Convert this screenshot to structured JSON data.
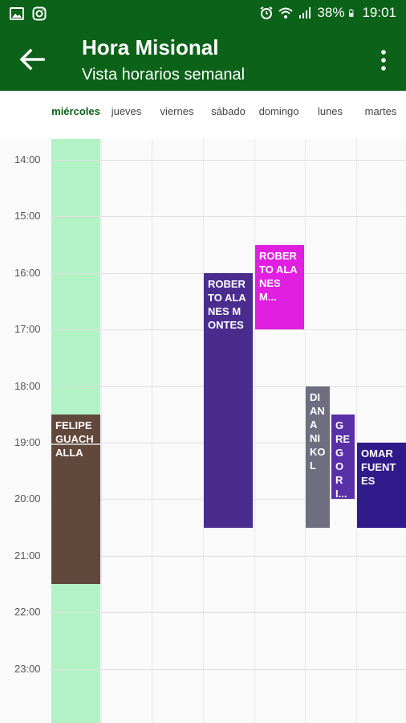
{
  "status_bar": {
    "battery": "38%",
    "time": "19:01"
  },
  "app_bar": {
    "title": "Hora Misional",
    "subtitle": "Vista horarios semanal"
  },
  "days": [
    "miércoles",
    "jueves",
    "viernes",
    "sábado",
    "domingo",
    "lunes",
    "martes"
  ],
  "hours": [
    "14:00",
    "15:00",
    "16:00",
    "17:00",
    "18:00",
    "19:00",
    "20:00",
    "21:00",
    "22:00",
    "23:00"
  ],
  "events": [
    {
      "text": "FELIPE GUACH ALLA",
      "day": "miércoles",
      "start": "18:30",
      "end": "21:30",
      "color": "#62473b"
    },
    {
      "text": "ROBERTO ALANES MONTES",
      "day": "sábado",
      "start": "16:00",
      "end": "20:30",
      "color": "#4a2c8f"
    },
    {
      "text": "ROBERTO ALANES M...",
      "day": "domingo",
      "start": "15:30",
      "end": "17:00",
      "color": "#e01fe0"
    },
    {
      "text": "DIANA NIKOL",
      "day": "lunes",
      "start": "18:00",
      "end": "20:30",
      "color": "#6e6e7f"
    },
    {
      "text": "GREGORI...",
      "day": "lunes",
      "start": "18:30",
      "end": "20:00",
      "color": "#5a30a8"
    },
    {
      "text": "OMAR FUENTES",
      "day": "martes",
      "start": "19:00",
      "end": "20:30",
      "color": "#2f1a8a"
    }
  ],
  "colors": {
    "primary": "#0b6218",
    "today_highlight": "#b2f2c4"
  }
}
